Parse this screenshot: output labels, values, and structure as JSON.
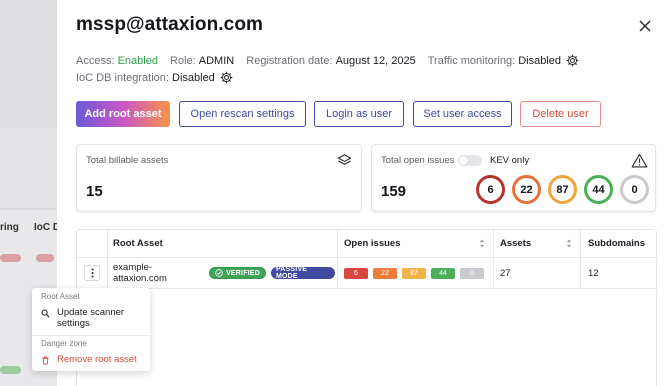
{
  "background": {
    "headers": [
      "ring",
      "IoC D"
    ]
  },
  "drawer": {
    "title": "mssp@attaxion.com",
    "meta": {
      "access_label": "Access:",
      "access_value": "Enabled",
      "role_label": "Role:",
      "role_value": "ADMIN",
      "reg_label": "Registration date:",
      "reg_value": "August 12, 2025",
      "traffic_label": "Traffic monitoring:",
      "traffic_value": "Disabled",
      "ioc_label": "IoC DB integration:",
      "ioc_value": "Disabled"
    },
    "buttons": {
      "add_root": "Add root asset",
      "rescan": "Open rescan settings",
      "login_as": "Login as user",
      "set_access": "Set user access",
      "delete": "Delete user"
    },
    "cards": {
      "billable_label": "Total billable assets",
      "billable_value": "15",
      "issues_label": "Total open issues",
      "kev_label": "KEV only",
      "issues_value": "159",
      "severity": [
        {
          "value": "6",
          "color": "#b8322e"
        },
        {
          "value": "22",
          "color": "#e8703a"
        },
        {
          "value": "87",
          "color": "#f0a640"
        },
        {
          "value": "44",
          "color": "#4caf5a"
        },
        {
          "value": "0",
          "color": "#c9c9cf"
        }
      ]
    },
    "table": {
      "columns": [
        "Root Asset",
        "Open issues",
        "Assets",
        "Subdomains"
      ],
      "rows": [
        {
          "root_asset": "example-attaxion.com",
          "verified": "VERIFIED",
          "passive": "PASSIVE MODE",
          "issues": [
            {
              "value": "6",
              "color": "#d9453f"
            },
            {
              "value": "22",
              "color": "#ee7d3c"
            },
            {
              "value": "87",
              "color": "#f2b34a"
            },
            {
              "value": "44",
              "color": "#4caf5a"
            },
            {
              "value": "0",
              "color": "#c9c9cf"
            }
          ],
          "assets": "27",
          "subdomains": "12"
        }
      ]
    }
  },
  "context_menu": {
    "section_root": "Root Asset",
    "update_scanner": "Update scanner settings",
    "section_danger": "Danger zone",
    "remove_root": "Remove root asset"
  }
}
